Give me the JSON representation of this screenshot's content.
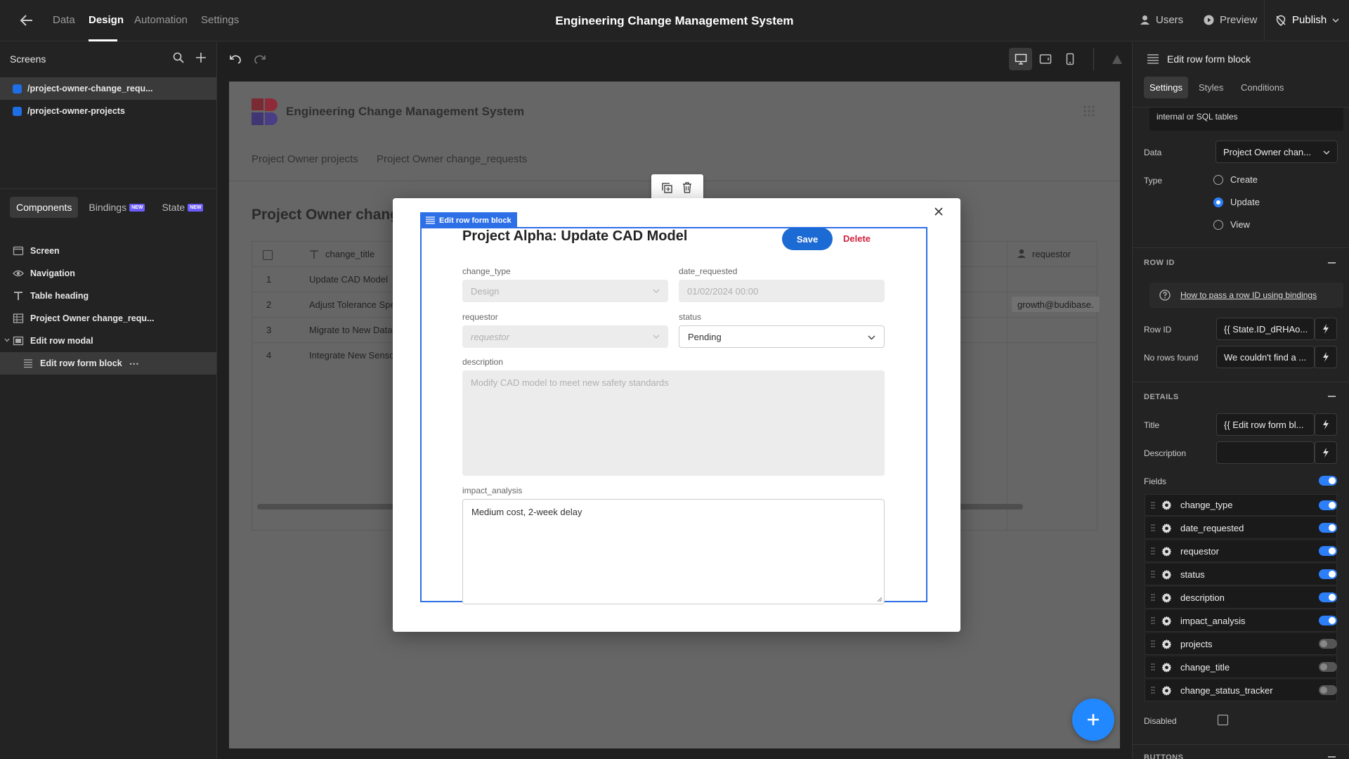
{
  "topbar": {
    "nav": [
      "Data",
      "Design",
      "Automation",
      "Settings"
    ],
    "active": "Design",
    "title": "Engineering Change Management System",
    "users": "Users",
    "preview": "Preview",
    "publish": "Publish"
  },
  "left": {
    "screens_title": "Screens",
    "screens": [
      "/project-owner-change_requ...",
      "/project-owner-projects"
    ],
    "tabs": {
      "components": "Components",
      "bindings": "Bindings",
      "state": "State",
      "new_badge": "NEW"
    },
    "tree": [
      {
        "label": "Screen",
        "icon": "screen-icon"
      },
      {
        "label": "Navigation",
        "icon": "eye-icon"
      },
      {
        "label": "Table heading",
        "icon": "text-icon"
      },
      {
        "label": "Project Owner change_requ...",
        "icon": "table-icon"
      },
      {
        "label": "Edit row modal",
        "icon": "modal-icon"
      },
      {
        "label": "Edit row form block",
        "icon": "form-icon"
      }
    ]
  },
  "canvas": {
    "app_title": "Engineering Change Management System",
    "nav": [
      "Project Owner projects",
      "Project Owner change_requests"
    ],
    "table_heading": "Project Owner change",
    "columns": {
      "title": "change_title",
      "requestor": "requestor"
    },
    "rows": [
      {
        "num": "1",
        "title": "Update CAD Model",
        "requestor": ""
      },
      {
        "num": "2",
        "title": "Adjust Tolerance Spe",
        "requestor": "growth@budibase."
      },
      {
        "num": "3",
        "title": "Migrate to New Data",
        "requestor": ""
      },
      {
        "num": "4",
        "title": "Integrate New Senso",
        "requestor": ""
      }
    ]
  },
  "modal": {
    "block_label": "Edit row form block",
    "title": "Project Alpha: Update CAD Model",
    "save": "Save",
    "delete": "Delete",
    "fields": {
      "change_type": {
        "label": "change_type",
        "value": "Design"
      },
      "date_requested": {
        "label": "date_requested",
        "value": "01/02/2024 00:00"
      },
      "requestor": {
        "label": "requestor",
        "placeholder": "requestor"
      },
      "status": {
        "label": "status",
        "value": "Pending"
      },
      "description": {
        "label": "description",
        "value": "Modify CAD model to meet new safety standards"
      },
      "impact_analysis": {
        "label": "impact_analysis",
        "value": "Medium cost, 2-week delay"
      }
    }
  },
  "right": {
    "header": "Edit row form block",
    "tabs": [
      "Settings",
      "Styles",
      "Conditions"
    ],
    "hint": "internal or SQL tables",
    "data_label": "Data",
    "data_value": "Project Owner chan...",
    "type_label": "Type",
    "type_options": [
      "Create",
      "Update",
      "View"
    ],
    "type_selected": "Update",
    "row_id_section": "ROW ID",
    "row_id_link": "How to pass a row ID using bindings",
    "row_id_label": "Row ID",
    "row_id_value": "{{ State.ID_dRHAo...",
    "no_rows_label": "No rows found",
    "no_rows_value": "We couldn't find a ...",
    "details_section": "DETAILS",
    "title_label": "Title",
    "title_value": "{{ Edit row form bl...",
    "description_label": "Description",
    "description_value": "",
    "fields_label": "Fields",
    "fields": [
      {
        "name": "change_type",
        "on": true
      },
      {
        "name": "date_requested",
        "on": true
      },
      {
        "name": "requestor",
        "on": true
      },
      {
        "name": "status",
        "on": true
      },
      {
        "name": "description",
        "on": true
      },
      {
        "name": "impact_analysis",
        "on": true
      },
      {
        "name": "projects",
        "on": false
      },
      {
        "name": "change_title",
        "on": false
      },
      {
        "name": "change_status_tracker",
        "on": false
      }
    ],
    "disabled_label": "Disabled",
    "buttons_section": "BUTTONS"
  },
  "colors": {
    "accent": "#2d7ff9",
    "brand_red": "#d9334a",
    "save_blue": "#1c6ad4"
  }
}
